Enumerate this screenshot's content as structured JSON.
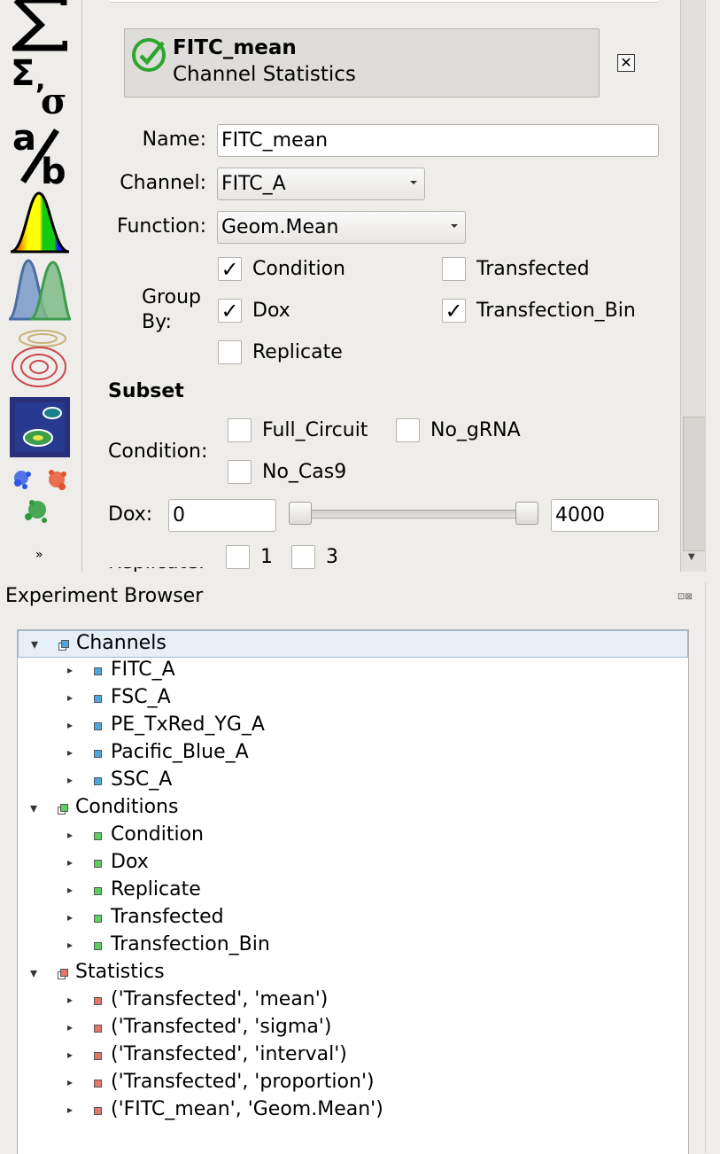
{
  "toolbar": {
    "tools": [
      "sum-icon",
      "sigma-sum-icon",
      "ratio-icon",
      "histogram-icon",
      "kde-icon",
      "density-contour-icon",
      "density-2d-icon",
      "scatter-icon"
    ],
    "more_label": "»"
  },
  "operation": {
    "title": "FITC_mean",
    "subtitle": "Channel Statistics",
    "close_glyph": "✕"
  },
  "form": {
    "name_label": "Name:",
    "name_value": "FITC_mean",
    "channel_label": "Channel:",
    "channel_value": "FITC_A",
    "function_label": "Function:",
    "function_value": "Geom.Mean",
    "groupby_label_1": "Group",
    "groupby_label_2": "By:",
    "groupby": [
      {
        "label": "Condition",
        "checked": "✓"
      },
      {
        "label": "Transfected",
        "checked": ""
      },
      {
        "label": "Dox",
        "checked": "✓"
      },
      {
        "label": "Transfection_Bin",
        "checked": "✓"
      },
      {
        "label": "Replicate",
        "checked": ""
      }
    ],
    "subset_heading": "Subset",
    "condition_label": "Condition:",
    "conditions": [
      {
        "label": "Full_Circuit",
        "checked": ""
      },
      {
        "label": "No_gRNA",
        "checked": ""
      },
      {
        "label": "No_Cas9",
        "checked": ""
      }
    ],
    "dox_label": "Dox:",
    "dox_min": "0",
    "dox_max": "4000",
    "replicate_options": [
      "1",
      "3"
    ]
  },
  "browser": {
    "title": "Experiment Browser",
    "buttons": "⊡⊠",
    "groups": [
      {
        "label": "Channels",
        "color": "#4da6e0",
        "items": [
          "FITC_A",
          "FSC_A",
          "PE_TxRed_YG_A",
          "Pacific_Blue_A",
          "SSC_A"
        ]
      },
      {
        "label": "Conditions",
        "color": "#5ccf5c",
        "items": [
          "Condition",
          "Dox",
          "Replicate",
          "Transfected",
          "Transfection_Bin"
        ]
      },
      {
        "label": "Statistics",
        "color": "#e4756a",
        "items": [
          "('Transfected', 'mean')",
          "('Transfected', 'sigma')",
          "('Transfected', 'interval')",
          "('Transfected', 'proportion')",
          "('FITC_mean', 'Geom.Mean')"
        ]
      }
    ]
  }
}
